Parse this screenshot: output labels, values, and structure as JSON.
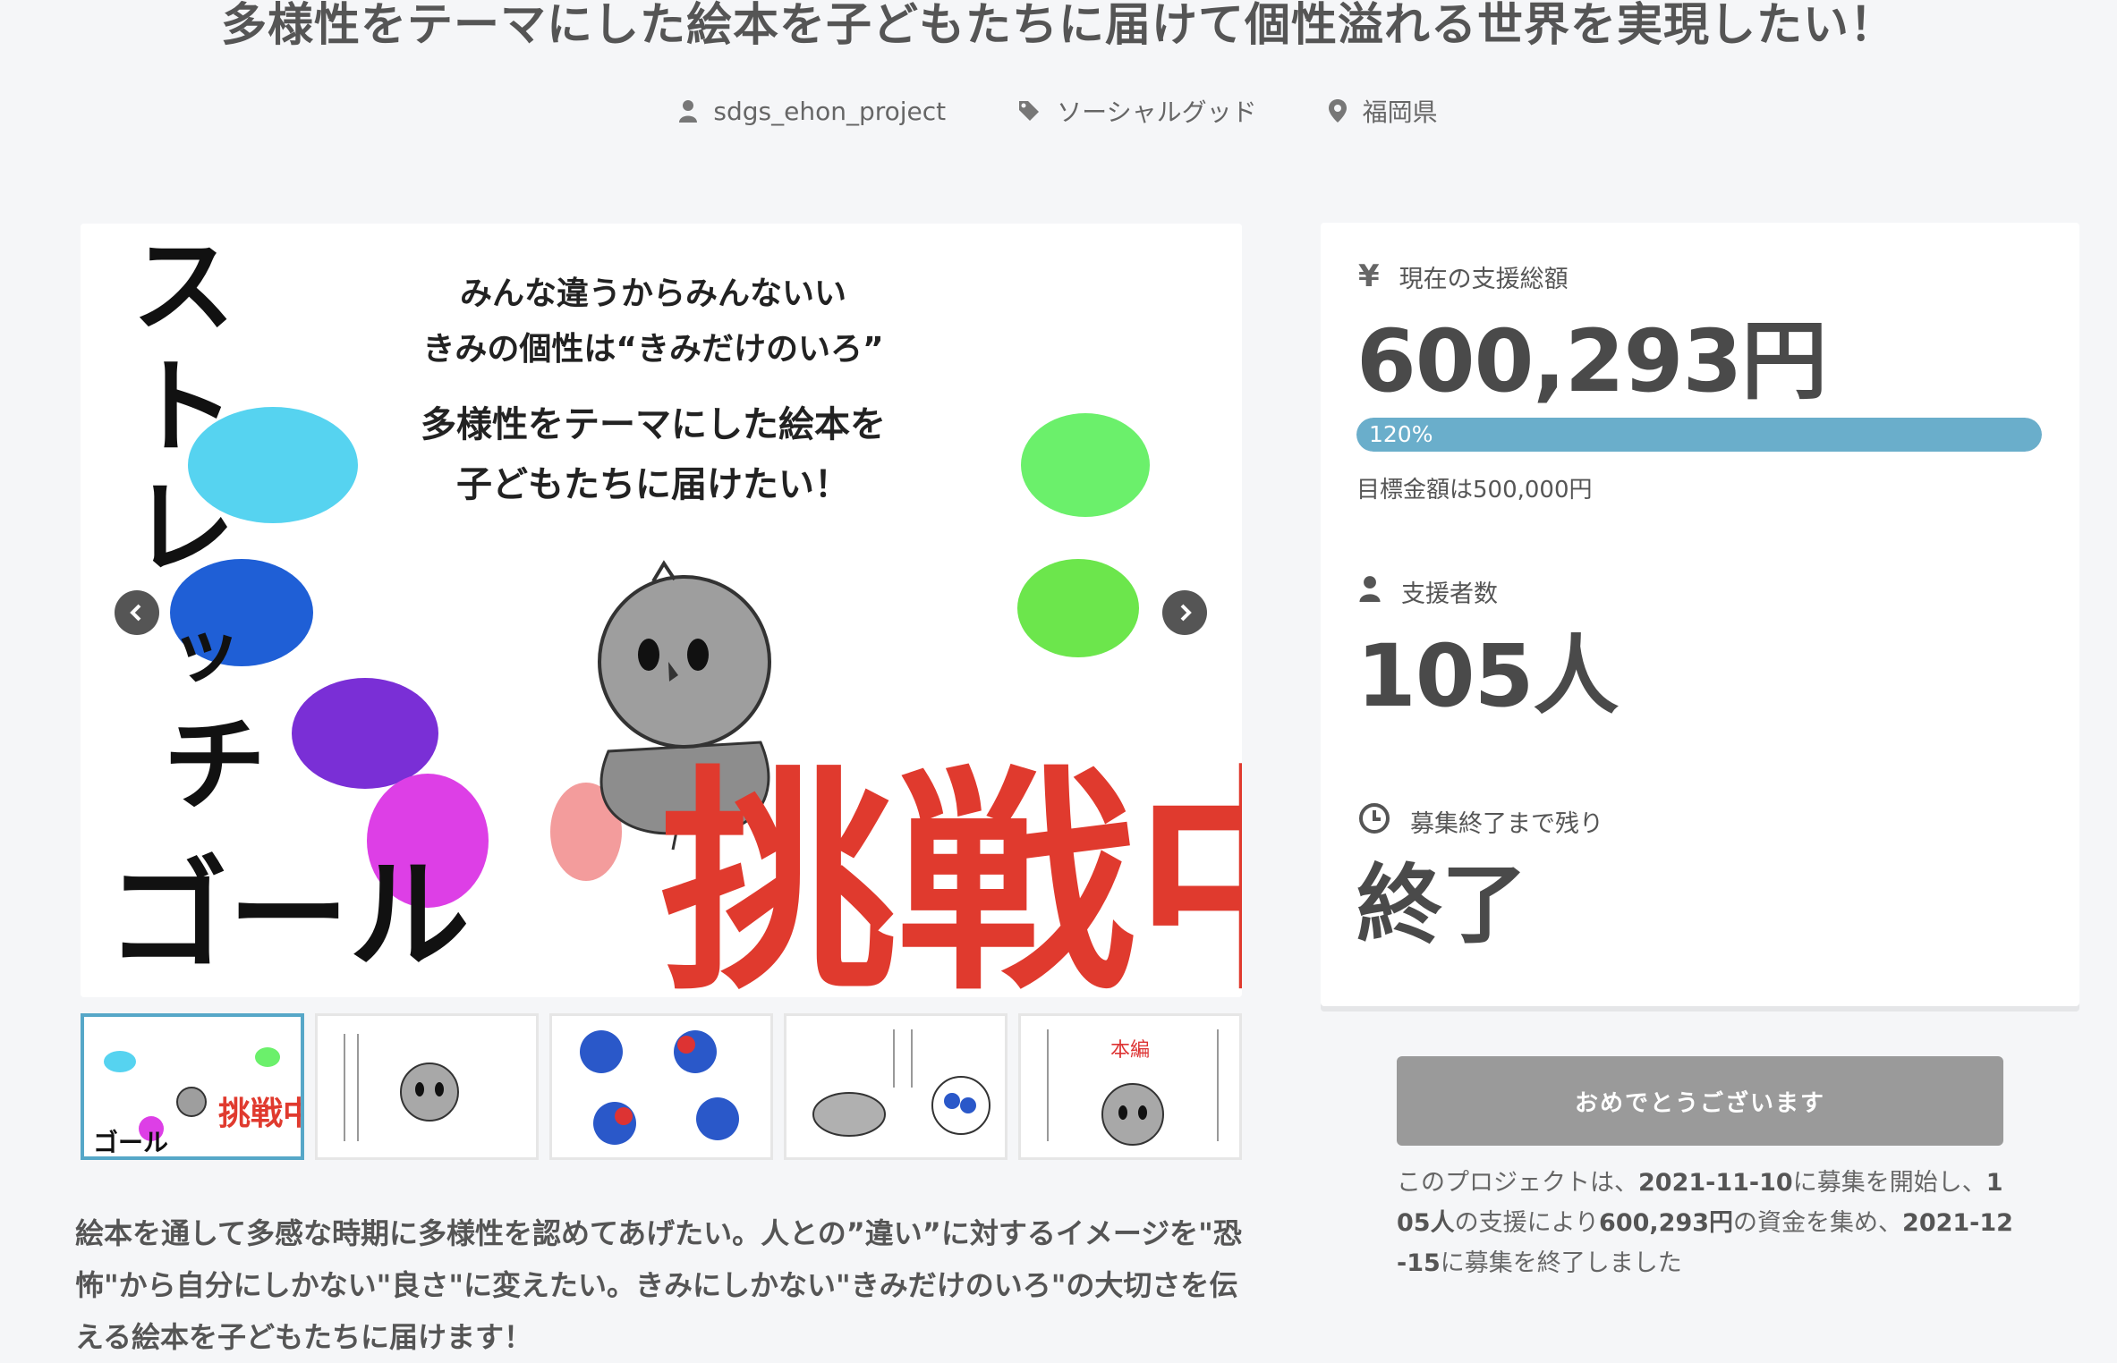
{
  "page": {
    "title": "多様性をテーマにした絵本を子どもたちに届けて個性溢れる世界を実現したい！"
  },
  "meta": {
    "user": "sdgs_ehon_project",
    "category": "ソーシャルグッド",
    "location": "福岡県"
  },
  "hero": {
    "top_lines": [
      "みんな違うからみんないい",
      "きみの個性は“きみだけのいろ”",
      "多様性をテーマにした絵本を",
      "子どもたちに届けたい！"
    ],
    "vertical_title": "ストレッチゴール",
    "challenge_text": "挑戦中"
  },
  "thumbnails": {
    "count": 5,
    "active_index": 0
  },
  "summary": "絵本を通して多感な時期に多様性を認めてあげたい。人との”違い”に対するイメージを\"恐怖\"から自分にしかない\"良さ\"に変えたい。きみにしかない\"きみだけのいろ\"の大切さを伝える絵本を子どもたちに届けます！",
  "stats": {
    "amount_label": "現在の支援総額",
    "amount_value": "600,293円",
    "progress_label": "120%",
    "progress_fraction": 1.0,
    "goal_text": "目標金額は500,000円",
    "backers_label": "支援者数",
    "backers_value": "105人",
    "remaining_label": "募集終了まで残り",
    "remaining_value": "終了"
  },
  "cta": {
    "label": "おめでとうございます"
  },
  "end_note": {
    "prefix": "このプロジェクトは、",
    "start_date": "2021-11-10",
    "mid1": "に募集を開始し、",
    "backers": "105人",
    "mid2": "の支援により",
    "amount": "600,293円",
    "mid3": "の資金を集め、",
    "end_date": "2021-12-15",
    "suffix": "に募集を終了しました"
  },
  "colors": {
    "accent": "#6aaecb",
    "thumb_active": "#56a7c8",
    "button_disabled": "#9a9a9a",
    "challenge_red": "#e03a2e"
  }
}
